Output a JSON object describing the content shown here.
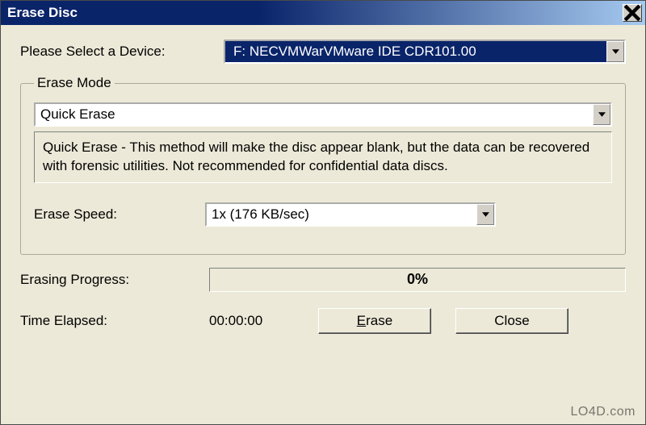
{
  "title": "Erase Disc",
  "device": {
    "label": "Please Select a Device:",
    "value": "F: NECVMWarVMware IDE CDR101.00"
  },
  "eraseMode": {
    "legend": "Erase Mode",
    "value": "Quick Erase",
    "description": "Quick Erase - This method will make the disc appear blank, but the data can be recovered with forensic utilities. Not recommended for confidential data discs."
  },
  "speed": {
    "label": "Erase Speed:",
    "value": "1x  (176 KB/sec)"
  },
  "progress": {
    "label": "Erasing Progress:",
    "percent": "0%"
  },
  "time": {
    "label": "Time Elapsed:",
    "value": "00:00:00"
  },
  "buttons": {
    "erase": "rase",
    "erase_u": "E",
    "close": "Close"
  },
  "watermark": "LO4D.com"
}
